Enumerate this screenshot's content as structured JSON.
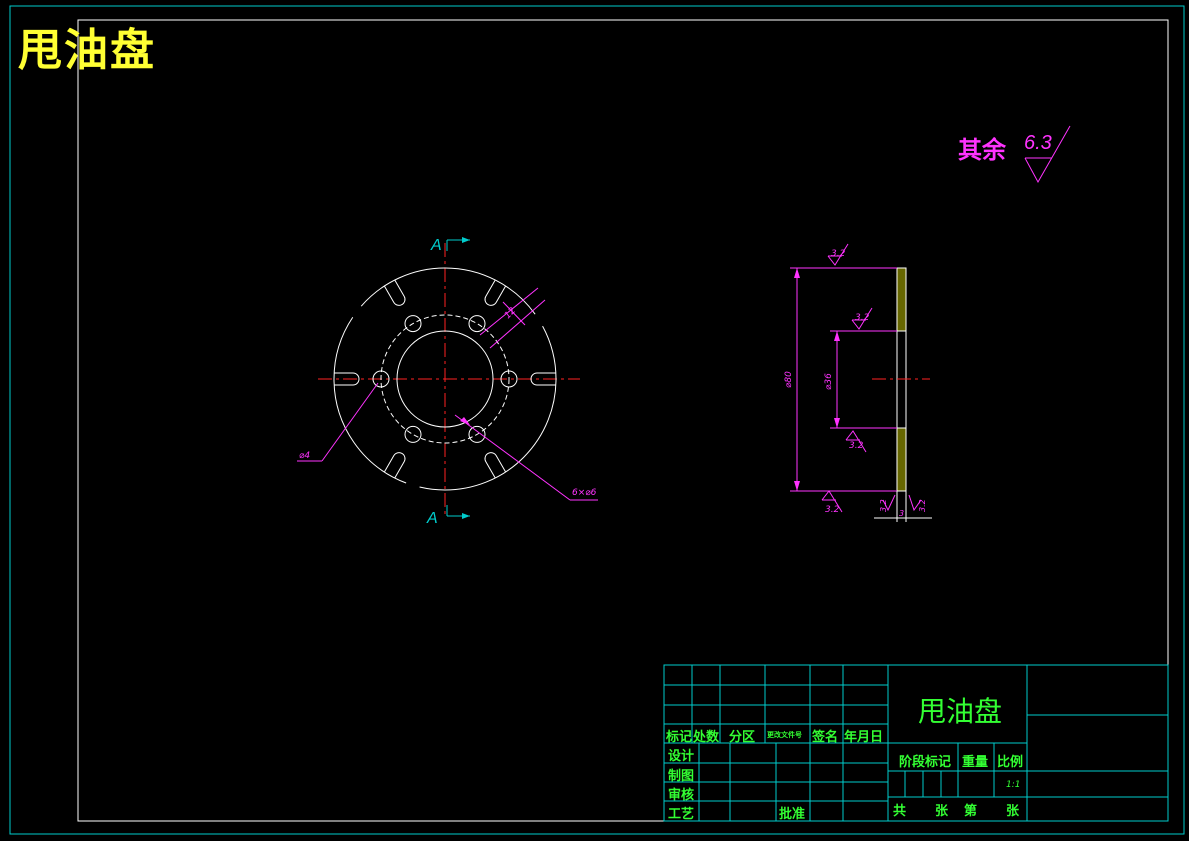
{
  "drawing": {
    "big_title": "甩油盘",
    "roughness_label": "其余",
    "roughness_value": "6.3"
  },
  "front_view": {
    "section_letter_top": "A",
    "section_letter_bottom": "A",
    "dim_hole": "⌀4",
    "dim_holes": "6×⌀6",
    "dim_slot": "12"
  },
  "section_view": {
    "dim_outer": "⌀80",
    "dim_inner": "⌀36",
    "rough_top": "3.2",
    "rough_mid": "3.2",
    "rough_lower": "3.2",
    "rough_bottom": "3.2",
    "rough_side1": "3.2",
    "rough_side2": "3.2",
    "dim_thickness": "3"
  },
  "title_block": {
    "part_name": "甩油盘",
    "h_mark": "标记",
    "h_count": "处数",
    "h_zone": "分区",
    "h_doc": "更改文件号",
    "h_sign": "签名",
    "h_date": "年月日",
    "r_design": "设计",
    "r_draw": "制图",
    "r_check": "审核",
    "r_process": "工艺",
    "r_approve": "批准",
    "stage": "阶段标记",
    "weight": "重量",
    "scale": "比例",
    "scale_value": "1:1",
    "total": "共",
    "sheet1": "张",
    "nth": "第",
    "sheet2": "张"
  }
}
